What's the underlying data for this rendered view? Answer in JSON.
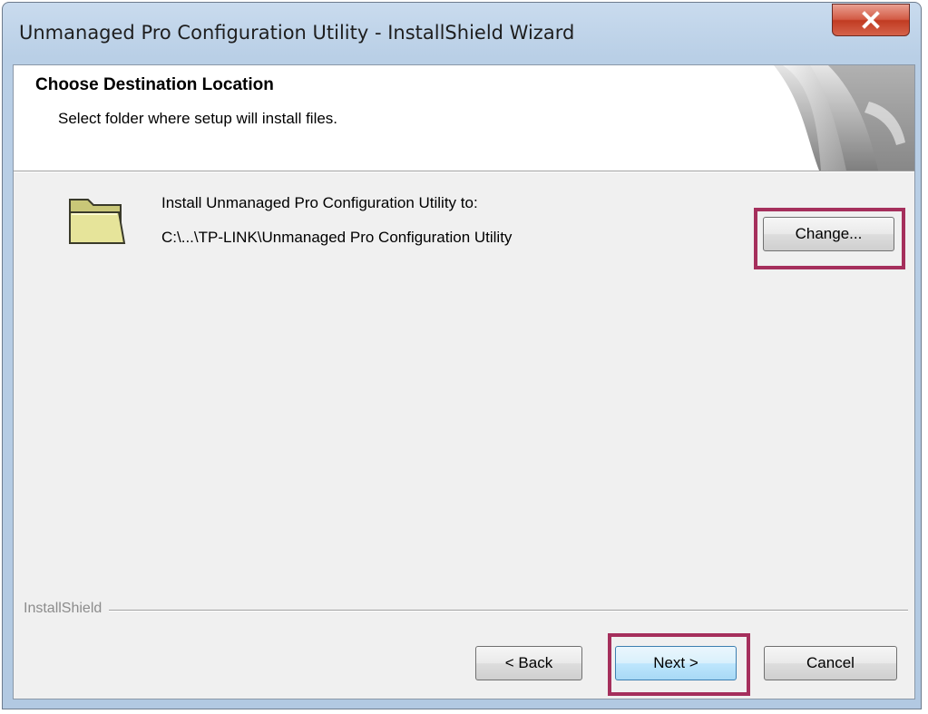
{
  "window": {
    "title": "Unmanaged Pro Configuration Utility - InstallShield Wizard"
  },
  "header": {
    "title": "Choose Destination Location",
    "subtitle": "Select folder where setup will install files."
  },
  "destination": {
    "label": "Install Unmanaged Pro Configuration Utility to:",
    "path": "C:\\...\\TP-LINK\\Unmanaged Pro Configuration Utility",
    "change_label": "Change..."
  },
  "footer": {
    "brand": "InstallShield",
    "back_label": "< Back",
    "next_label": "Next >",
    "cancel_label": "Cancel"
  },
  "icons": {
    "close": "close-icon",
    "folder": "folder-icon",
    "header_art": "header-art-graphic"
  },
  "colors": {
    "highlight": "#a52f5c",
    "close_button": "#c13b22",
    "dialog_background": "#f0f0f0"
  }
}
